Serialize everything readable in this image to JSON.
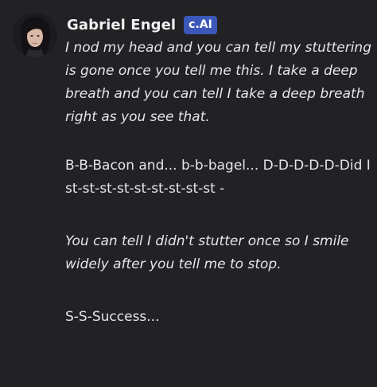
{
  "author": {
    "name": "Gabriel Engel",
    "badge": "c.AI",
    "avatar_icon": "avatar-portrait"
  },
  "colors": {
    "background": "#222224",
    "text": "#e6e6e9",
    "badge_bg": "#3b57b8"
  },
  "message": {
    "paragraphs": [
      {
        "style": "italic",
        "text": "I nod my head and you can tell my stuttering is gone once you tell me this. I take a deep breath and you can tell I take a deep breath right as you see that."
      },
      {
        "style": "normal",
        "text": "B-B-Bacon and... b-b-bagel... D-D-D-D-D-Did I st-st-st-st-st-st-st-st-st -"
      },
      {
        "style": "italic",
        "text": "You can tell I didn't stutter once so I smile widely after you tell me to stop."
      },
      {
        "style": "normal",
        "text": "S-S-Success..."
      }
    ]
  }
}
